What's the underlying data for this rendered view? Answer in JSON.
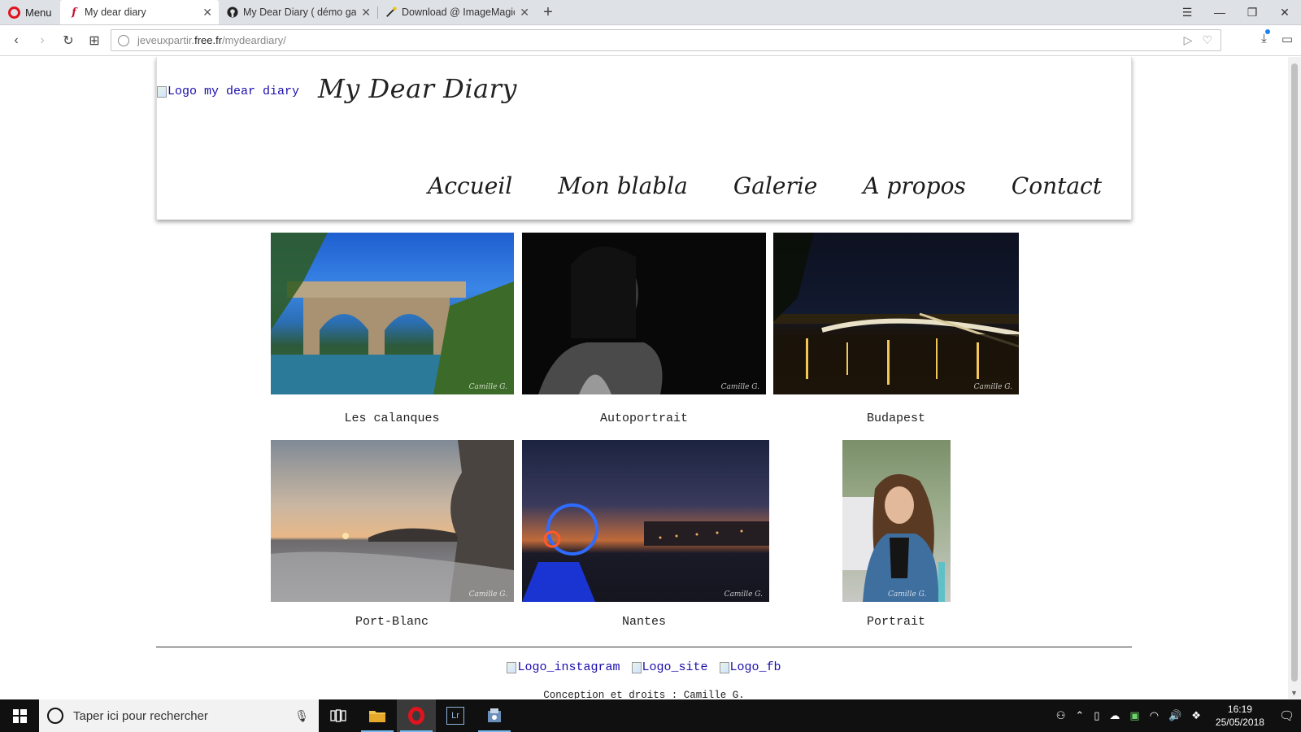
{
  "browser": {
    "menu_label": "Menu",
    "tabs": [
      {
        "title": "My dear diary",
        "active": true,
        "favicon": "script-f-icon"
      },
      {
        "title": "My Dear Diary ( démo gall",
        "active": false,
        "favicon": "github-icon"
      },
      {
        "title": "Download @ ImageMagic",
        "active": false,
        "favicon": "imagemagick-wand-icon"
      }
    ],
    "url_prefix": "jeveuxpartir.",
    "url_domain": "free.fr",
    "url_path": "/mydeardiary/"
  },
  "page": {
    "logo_alt": "Logo my dear diary",
    "site_title": "My Dear Diary",
    "nav": [
      "Accueil",
      "Mon blabla",
      "Galerie",
      "A propos",
      "Contact"
    ],
    "gallery": [
      {
        "label": "Les calanques",
        "signature": "Camille G."
      },
      {
        "label": "Autoportrait",
        "signature": "Camille G."
      },
      {
        "label": "Budapest",
        "signature": "Camille G."
      },
      {
        "label": "Port-Blanc",
        "signature": "Camille G."
      },
      {
        "label": "Nantes",
        "signature": "Camille G."
      },
      {
        "label": "Portrait",
        "signature": "Camille G."
      }
    ],
    "social": [
      "Logo_instagram",
      "Logo_site",
      "Logo_fb"
    ],
    "copyright": "Conception et droits : Camille G."
  },
  "taskbar": {
    "search_placeholder": "Taper ici pour rechercher",
    "time": "16:19",
    "date": "25/05/2018"
  }
}
